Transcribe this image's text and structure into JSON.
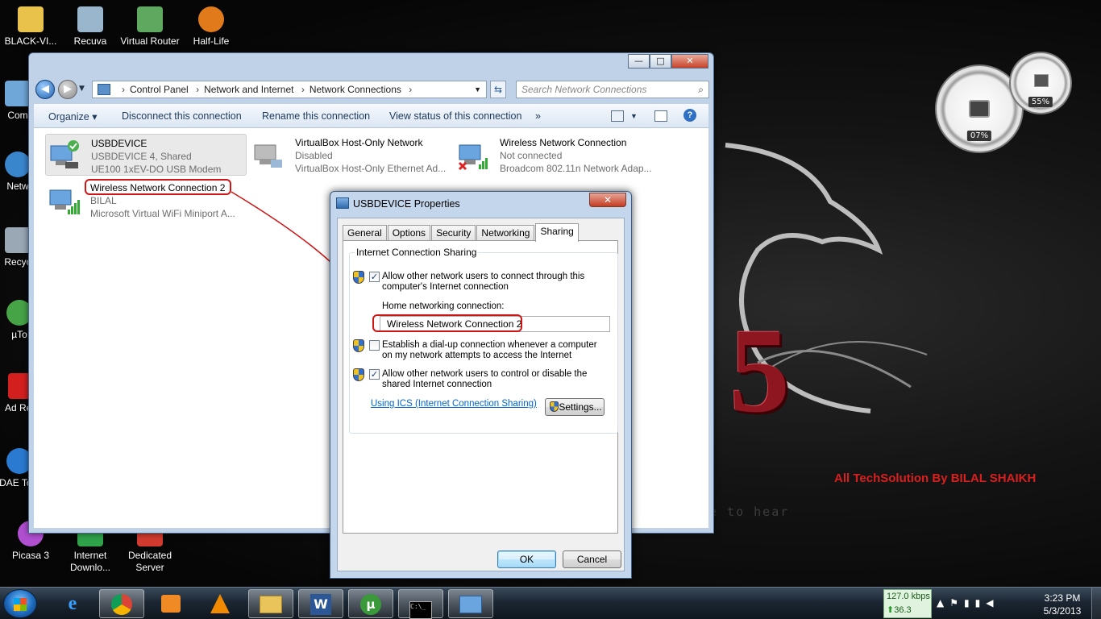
{
  "desktop": {
    "icons": [
      {
        "label": "BLACK-VI...",
        "color": "#e8c24a"
      },
      {
        "label": "Recuva",
        "color": "#9ab6cc"
      },
      {
        "label": "Virtual Router",
        "color": "#5fa85f"
      },
      {
        "label": "Half-Life",
        "color": "#e07a1a"
      },
      {
        "label": "Com",
        "color": "#6fa7d9"
      },
      {
        "label": "Netw",
        "color": "#3a86cc"
      },
      {
        "label": "Recyc",
        "color": "#9aa7b5"
      },
      {
        "label": "µTo",
        "color": "#46a346"
      },
      {
        "label": "Ad Rea",
        "color": "#d41f1f"
      },
      {
        "label": "DAE Tool",
        "color": "#2a7ad1"
      },
      {
        "label": "Picasa 3",
        "color": "#b14fd1"
      },
      {
        "label": "Internet Downlo...",
        "color": "#2fa24a"
      },
      {
        "label": "Dedicated Server",
        "color": "#d13b2f"
      }
    ],
    "gauges": [
      {
        "value": "07%"
      },
      {
        "value": "55%"
      }
    ],
    "brand_text": "All TechSolution By BILAL SHAIKH",
    "bg_text": "e to hear"
  },
  "explorer": {
    "breadcrumb": [
      "Control Panel",
      "Network and Internet",
      "Network Connections"
    ],
    "search_placeholder": "Search Network Connections",
    "toolbar": {
      "organize": "Organize ▾",
      "disconnect": "Disconnect this connection",
      "rename": "Rename this connection",
      "view_status": "View status of this connection",
      "more": "»"
    },
    "connections": [
      {
        "name": "USBDEVICE",
        "status": "USBDEVICE  4, Shared",
        "adapter": "UE100 1xEV-DO USB Modem"
      },
      {
        "name": "VirtualBox Host-Only Network",
        "status": "Disabled",
        "adapter": "VirtualBox Host-Only Ethernet Ad..."
      },
      {
        "name": "Wireless Network Connection",
        "status": "Not connected",
        "adapter": "Broadcom 802.11n Network Adap..."
      },
      {
        "name": "Wireless Network Connection 2",
        "status": "BILAL",
        "adapter": "Microsoft Virtual WiFi Miniport A..."
      }
    ]
  },
  "dialog": {
    "title": "USBDEVICE Properties",
    "close": "✕",
    "tabs": [
      "General",
      "Options",
      "Security",
      "Networking",
      "Sharing"
    ],
    "active_tab": "Sharing",
    "group_title": "Internet Connection Sharing",
    "opt1": "Allow other network users to connect through this computer's Internet connection",
    "opt1_checked": true,
    "home_label": "Home networking connection:",
    "home_value": "Wireless Network Connection 2",
    "opt2": "Establish a dial-up connection whenever a computer on my network attempts to access the Internet",
    "opt2_checked": false,
    "opt3": "Allow other network users to control or disable the shared Internet connection",
    "opt3_checked": true,
    "link": "Using ICS (Internet Connection Sharing)",
    "settings": "Settings...",
    "ok": "OK",
    "cancel": "Cancel"
  },
  "taskbar": {
    "net_down": "127.0 kbps",
    "net_up": "36.3 kbps",
    "time": "3:23 PM",
    "date": "5/3/2013"
  }
}
